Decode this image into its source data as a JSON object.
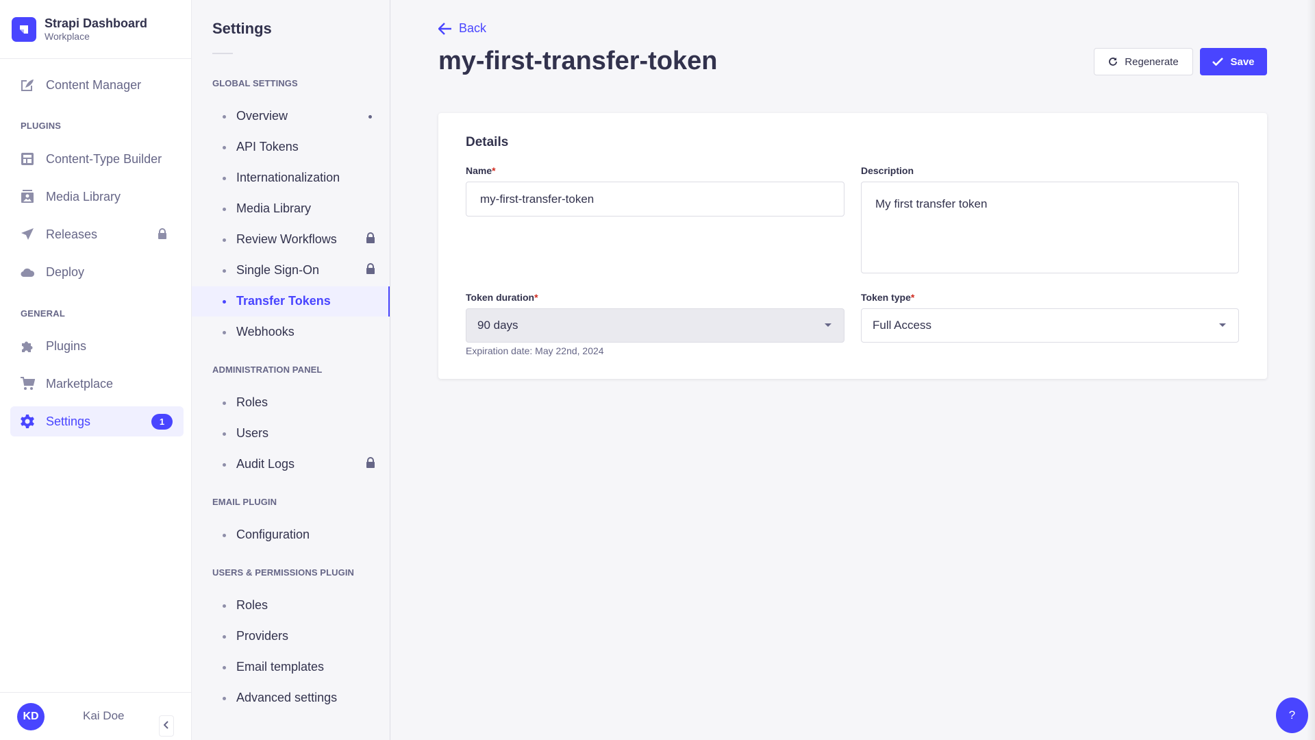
{
  "brand": {
    "title": "Strapi Dashboard",
    "subtitle": "Workplace"
  },
  "mainnav": {
    "items": [
      {
        "label": "Content Manager",
        "icon": "feather-icon"
      },
      {
        "label": "Content-Type Builder",
        "icon": "layout-icon"
      },
      {
        "label": "Media Library",
        "icon": "image-icon"
      },
      {
        "label": "Releases",
        "icon": "paper-plane-icon",
        "locked": true
      },
      {
        "label": "Deploy",
        "icon": "cloud-icon"
      },
      {
        "label": "Plugins",
        "icon": "puzzle-icon"
      },
      {
        "label": "Marketplace",
        "icon": "cart-icon"
      },
      {
        "label": "Settings",
        "icon": "cog-icon",
        "active": true,
        "badge": "1"
      }
    ],
    "sections": {
      "plugins": "PLUGINS",
      "general": "GENERAL"
    },
    "user": {
      "initials": "KD",
      "name": "Kai Doe"
    }
  },
  "subnav": {
    "title": "Settings",
    "sections": [
      {
        "label": "GLOBAL SETTINGS",
        "items": [
          "Overview",
          "API Tokens",
          "Internationalization",
          "Media Library",
          "Review Workflows",
          "Single Sign-On",
          "Transfer Tokens",
          "Webhooks"
        ]
      },
      {
        "label": "ADMINISTRATION PANEL",
        "items": [
          "Roles",
          "Users",
          "Audit Logs"
        ]
      },
      {
        "label": "EMAIL PLUGIN",
        "items": [
          "Configuration"
        ]
      },
      {
        "label": "USERS & PERMISSIONS PLUGIN",
        "items": [
          "Roles",
          "Providers",
          "Email templates",
          "Advanced settings"
        ]
      }
    ],
    "active_item": "Transfer Tokens"
  },
  "main": {
    "back_label": "Back",
    "title": "my-first-transfer-token",
    "regenerate_label": "Regenerate",
    "save_label": "Save",
    "details": {
      "title": "Details",
      "name_label": "Name",
      "name_value": "my-first-transfer-token",
      "description_label": "Description",
      "description_value": "My first transfer token",
      "duration_label": "Token duration",
      "duration_value": "90 days",
      "expiration_hint": "Expiration date: May 22nd, 2024",
      "type_label": "Token type",
      "type_value": "Full Access",
      "required_mark": "*"
    }
  },
  "help": {
    "label": "?"
  },
  "colors": {
    "primary": "#4945ff",
    "required": "#d02b20",
    "text": "#32324d",
    "muted": "#666687"
  }
}
